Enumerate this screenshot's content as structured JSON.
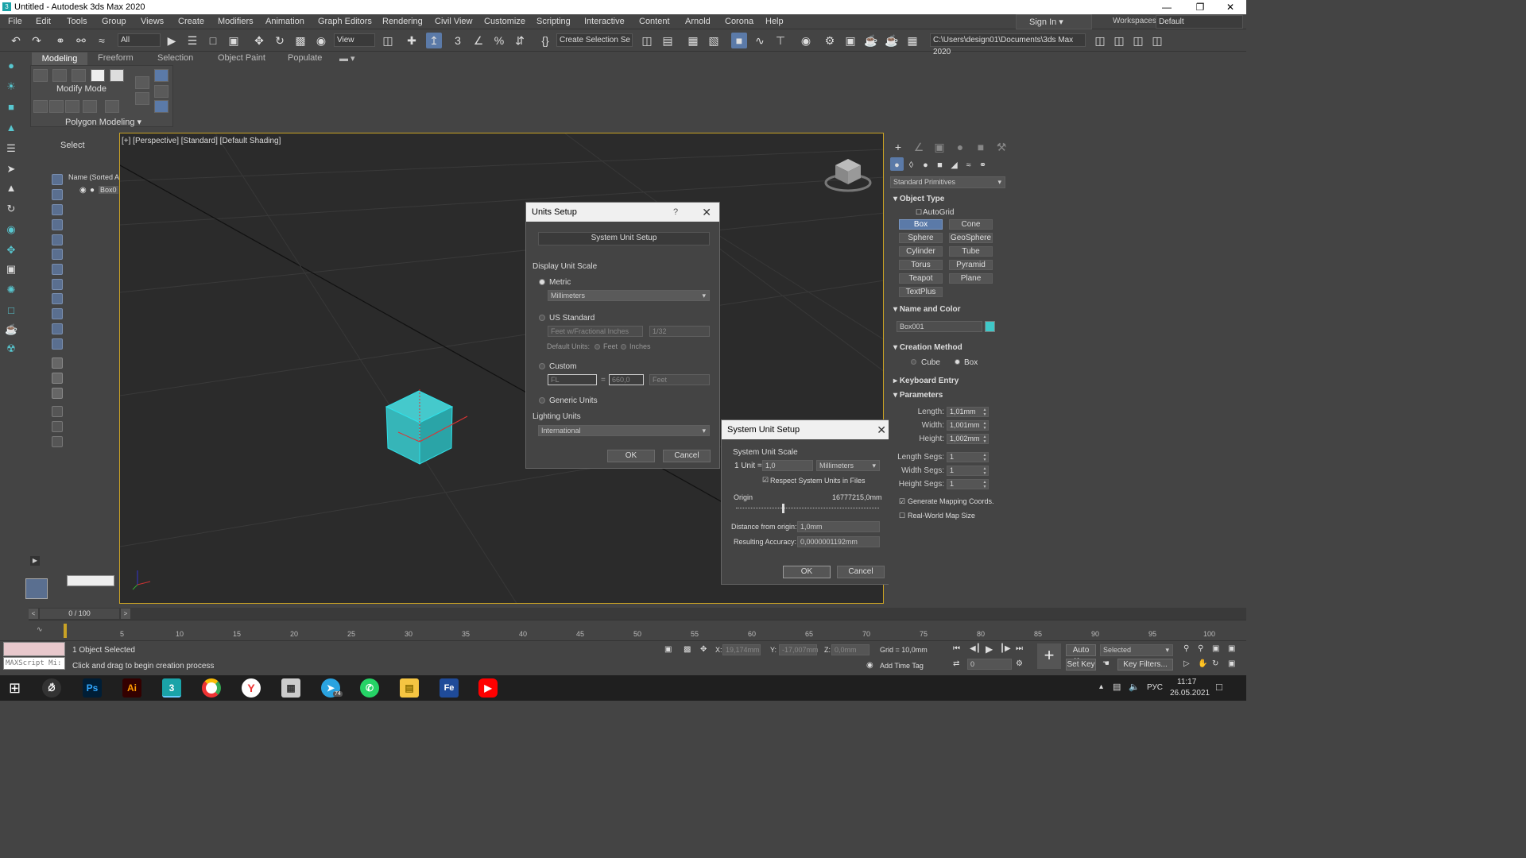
{
  "window": {
    "title": "Untitled - Autodesk 3ds Max 2020",
    "logo": "3"
  },
  "menu": [
    "File",
    "Edit",
    "Tools",
    "Group",
    "Views",
    "Create",
    "Modifiers",
    "Animation",
    "Graph Editors",
    "Rendering",
    "Civil View",
    "Customize",
    "Scripting",
    "Interactive",
    "Content",
    "Arnold",
    "Corona",
    "Help"
  ],
  "signin": "Sign In",
  "workspaces": {
    "label": "Workspaces:",
    "value": "Default"
  },
  "toolbar": {
    "filter": "All",
    "refcoord": "View",
    "selection_set": "Create Selection Se",
    "project_path": "C:\\Users\\design01\\Documents\\3ds Max 2020"
  },
  "ribbon": {
    "tabs": [
      "Modeling",
      "Freeform",
      "Selection",
      "Object Paint",
      "Populate"
    ],
    "modify_mode": "Modify Mode",
    "polygon_modeling": "Polygon Modeling"
  },
  "scene_explorer": {
    "select": "Select",
    "column": "Name (Sorted A",
    "item": "Box0"
  },
  "viewport": {
    "label": "[+] [Perspective] [Standard] [Default Shading]"
  },
  "units_setup": {
    "title": "Units Setup",
    "help": "?",
    "system_unit_button": "System Unit Setup",
    "display_unit_scale": "Display Unit Scale",
    "metric_label": "Metric",
    "metric_value": "Millimeters",
    "us_label": "US Standard",
    "us_value": "Feet w/Fractional Inches",
    "us_fraction": "1/32",
    "default_units": "Default Units:",
    "feet": "Feet",
    "inches": "Inches",
    "custom_label": "Custom",
    "custom_name": "FL",
    "custom_value": "660,0",
    "custom_unit": "Feet",
    "custom_equals": "=",
    "generic_label": "Generic Units",
    "lighting_units": "Lighting Units",
    "lighting_value": "International",
    "ok": "OK",
    "cancel": "Cancel"
  },
  "system_unit_setup": {
    "title": "System Unit Setup",
    "scale_label": "System Unit Scale",
    "unit_label": "1 Unit =",
    "unit_value": "1,0",
    "unit_type": "Millimeters",
    "respect_label": "Respect System Units in Files",
    "origin_label": "Origin",
    "origin_value": "16777215,0mm",
    "distance_label": "Distance from origin:",
    "distance_value": "1,0mm",
    "accuracy_label": "Resulting Accuracy:",
    "accuracy_value": "0,0000001192mm",
    "ok": "OK",
    "cancel": "Cancel"
  },
  "command_panel": {
    "category": "Standard Primitives",
    "object_type": "Object Type",
    "autogrid": "AutoGrid",
    "buttons": [
      "Box",
      "Cone",
      "Sphere",
      "GeoSphere",
      "Cylinder",
      "Tube",
      "Torus",
      "Pyramid",
      "Teapot",
      "Plane",
      "TextPlus"
    ],
    "name_color": "Name and Color",
    "object_name": "Box001",
    "object_color": "#3fc8c8",
    "creation_method": "Creation Method",
    "cm_cube": "Cube",
    "cm_box": "Box",
    "keyboard_entry": "Keyboard Entry",
    "parameters": "Parameters",
    "length_label": "Length:",
    "length": "1,01mm",
    "width_label": "Width:",
    "width": "1,001mm",
    "height_label": "Height:",
    "height": "1,002mm",
    "length_segs_label": "Length Segs:",
    "length_segs": "1",
    "width_segs_label": "Width Segs:",
    "width_segs": "1",
    "height_segs_label": "Height Segs:",
    "height_segs": "1",
    "gen_mapping": "Generate Mapping Coords.",
    "real_world": "Real-World Map Size"
  },
  "timeline": {
    "frame": "0 / 100",
    "ticks": [
      "5",
      "10",
      "15",
      "20",
      "25",
      "30",
      "35",
      "40",
      "45",
      "50",
      "55",
      "60",
      "65",
      "70",
      "75",
      "80",
      "85",
      "90",
      "95",
      "100"
    ]
  },
  "status": {
    "selected": "1 Object Selected",
    "prompt": "Click and drag to begin creation process",
    "maxscript": "MAXScript Mi:",
    "x_label": "X:",
    "x": "19,174mm",
    "y_label": "Y:",
    "y": "-17,007mm",
    "z_label": "Z:",
    "z": "0,0mm",
    "grid": "Grid = 10,0mm",
    "add_time_tag": "Add Time Tag",
    "frame_field": "0",
    "auto_key": "Auto Key",
    "set_key": "Set Key",
    "selected_drop": "Selected",
    "key_filters": "Key Filters..."
  },
  "taskbar": {
    "apps": [
      "Ps",
      "Ai",
      "3",
      "Fe"
    ],
    "badge": "74",
    "lang": "РУС",
    "time": "11:17",
    "date": "26.05.2021"
  }
}
